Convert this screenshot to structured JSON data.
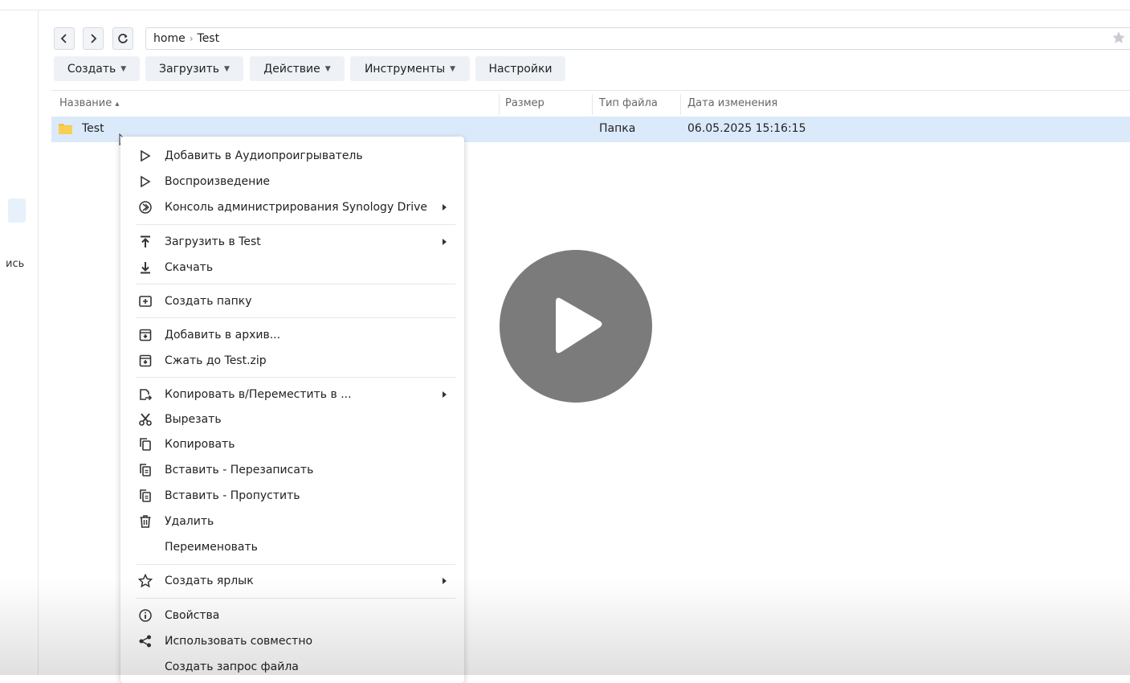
{
  "sidebar": {
    "partial_text": "ись"
  },
  "nav": {
    "path": [
      "home",
      "Test"
    ],
    "back_icon": "chevron-left-icon",
    "forward_icon": "chevron-right-icon",
    "refresh_icon": "refresh-icon"
  },
  "toolbar": [
    {
      "label": "Создать",
      "has_caret": true
    },
    {
      "label": "Загрузить",
      "has_caret": true
    },
    {
      "label": "Действие",
      "has_caret": true
    },
    {
      "label": "Инструменты",
      "has_caret": true
    },
    {
      "label": "Настройки",
      "has_caret": false
    }
  ],
  "table": {
    "columns": [
      "Название",
      "Размер",
      "Тип файла",
      "Дата изменения"
    ],
    "sort_indicator": "▴",
    "rows": [
      {
        "name": "Test",
        "size": "",
        "type": "Папка",
        "modified": "06.05.2025 15:16:15",
        "selected": true
      }
    ]
  },
  "context_menu": {
    "items": [
      {
        "label": "Добавить в Аудиопроигрыватель",
        "icon": "play-outline-icon",
        "submenu": false
      },
      {
        "label": "Воспроизведение",
        "icon": "play-outline-icon",
        "submenu": false
      },
      {
        "label": "Консоль администрирования Synology Drive",
        "icon": "synology-drive-icon",
        "submenu": true
      },
      {
        "label": "Загрузить в Test",
        "icon": "upload-icon",
        "submenu": true
      },
      {
        "label": "Скачать",
        "icon": "download-icon",
        "submenu": false
      },
      {
        "label": "Создать папку",
        "icon": "new-folder-icon",
        "submenu": false
      },
      {
        "label": "Добавить в архив...",
        "icon": "archive-icon",
        "submenu": false
      },
      {
        "label": "Сжать до Test.zip",
        "icon": "archive-icon",
        "submenu": false
      },
      {
        "label": "Копировать в/Переместить в ...",
        "icon": "copy-move-icon",
        "submenu": true
      },
      {
        "label": "Вырезать",
        "icon": "scissors-icon",
        "submenu": false
      },
      {
        "label": "Копировать",
        "icon": "copy-icon",
        "submenu": false
      },
      {
        "label": "Вставить - Перезаписать",
        "icon": "paste-icon",
        "submenu": false
      },
      {
        "label": "Вставить - Пропустить",
        "icon": "paste-icon",
        "submenu": false
      },
      {
        "label": "Удалить",
        "icon": "trash-icon",
        "submenu": false
      },
      {
        "label": "Переименовать",
        "icon": "",
        "submenu": false
      },
      {
        "label": "Создать ярлык",
        "icon": "star-outline-icon",
        "submenu": true
      },
      {
        "label": "Свойства",
        "icon": "info-icon",
        "submenu": false
      },
      {
        "label": "Использовать совместно",
        "icon": "share-icon",
        "submenu": false
      },
      {
        "label": "Создать запрос файла",
        "icon": "",
        "submenu": false
      }
    ]
  },
  "overlay": {
    "icon": "video-play-icon"
  },
  "colors": {
    "selection": "#dbeafb",
    "folder": "#f5c342",
    "button_bg": "#eef1f5"
  }
}
